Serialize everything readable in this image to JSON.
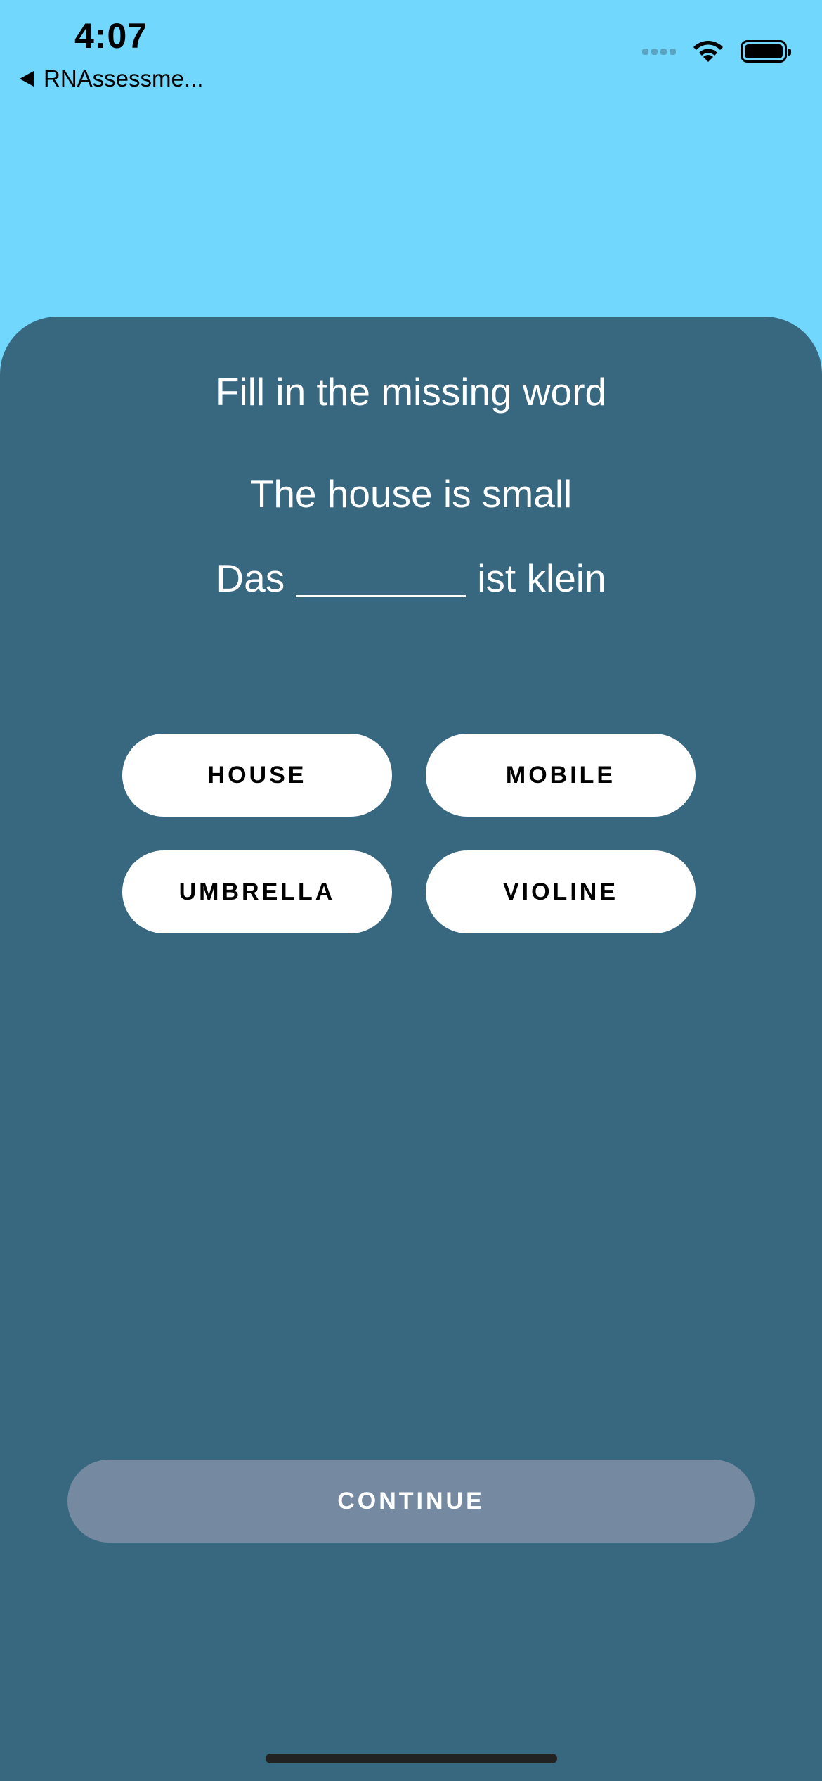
{
  "status_bar": {
    "time": "4:07",
    "back_app_label": "RNAssessme...",
    "icons": [
      "back-arrow-icon",
      "signal-icon",
      "wifi-icon",
      "battery-icon"
    ]
  },
  "exercise": {
    "instruction": "Fill in the missing word",
    "source_sentence": "The house is small",
    "target_before": "Das",
    "target_after": "ist klein",
    "options": [
      "HOUSE",
      "MOBILE",
      "UMBRELLA",
      "VIOLINE"
    ],
    "continue_label": "CONTINUE"
  },
  "colors": {
    "background": "#72d7fd",
    "card": "#386780",
    "option_bg": "#ffffff",
    "continue_disabled": "#758aa0"
  }
}
